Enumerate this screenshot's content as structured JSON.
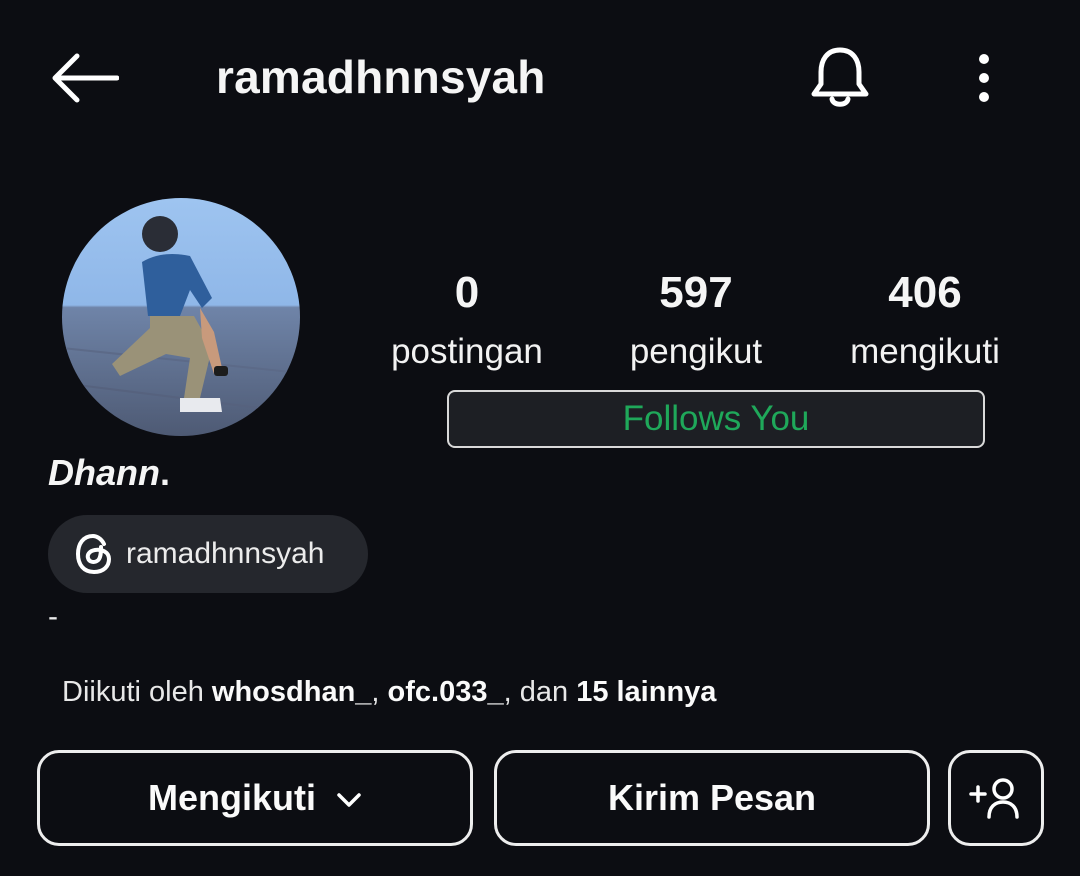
{
  "header": {
    "title": "ramadhnnsyah",
    "icons": {
      "back": "arrow-left-icon",
      "notifications": "bell-icon",
      "more": "more-vertical-icon"
    }
  },
  "profile": {
    "avatar_icon": "profile-photo",
    "stats": [
      {
        "value": "0",
        "label": "postingan"
      },
      {
        "value": "597",
        "label": "pengikut"
      },
      {
        "value": "406",
        "label": "mengikuti"
      }
    ],
    "follows_you": "Follows You",
    "follows_you_color": "#1fa85a",
    "display_name": "Dhann",
    "display_name_suffix": ".",
    "threads": {
      "icon": "threads-icon",
      "handle": "ramadhnnsyah"
    },
    "bio": "-",
    "followed_by": {
      "prefix": "Diikuti oleh ",
      "user1": "whosdhan_",
      "sep": ", ",
      "user2": "ofc.033_",
      "mid": ", dan ",
      "rest": "15 lainnya"
    }
  },
  "actions": {
    "following_label": "Mengikuti",
    "following_icon": "chevron-down-icon",
    "message_label": "Kirim Pesan",
    "add_user_icon": "add-person-icon"
  }
}
